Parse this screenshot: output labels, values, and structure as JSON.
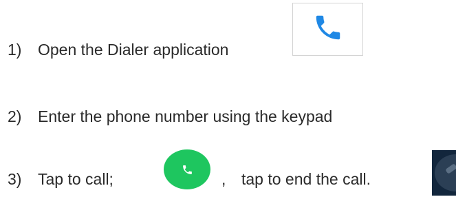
{
  "steps": [
    {
      "number": "1)",
      "text": "Open the Dialer application"
    },
    {
      "number": "2)",
      "text": "Enter the phone number using the keypad"
    },
    {
      "number": "3)",
      "text_before": "Tap to call;",
      "text_middle": ",",
      "text_after": "tap to end the call."
    }
  ],
  "icons": {
    "dialer_app": "phone-icon",
    "call": "phone-icon",
    "end_call": "end-call-icon"
  },
  "colors": {
    "dialer_phone_blue": "#1f88e5",
    "call_button_green": "#1ec65f",
    "end_call_dark": "#12263c"
  }
}
